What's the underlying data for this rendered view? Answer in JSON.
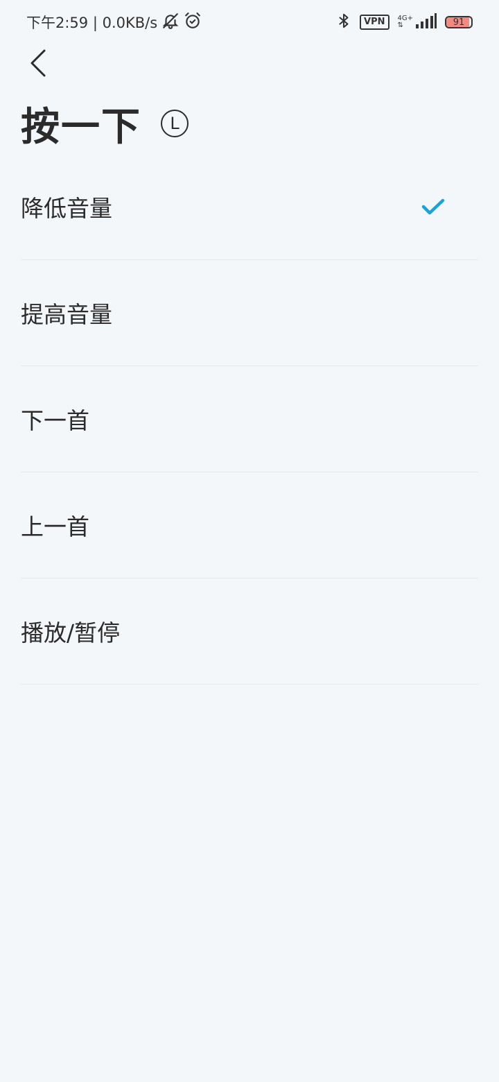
{
  "status_bar": {
    "time_speed": "下午2:59 | 0.0KB/s",
    "vpn_label": "VPN",
    "network_type": "4G+",
    "battery_level": "91",
    "battery_fraction": 0.91,
    "icons": [
      "bell-off-icon",
      "alarm-icon",
      "bluetooth-icon",
      "signal-icon"
    ]
  },
  "header": {
    "title": "按一下",
    "side_badge": "L"
  },
  "options": [
    {
      "label": "降低音量",
      "selected": true
    },
    {
      "label": "提高音量",
      "selected": false
    },
    {
      "label": "下一首",
      "selected": false
    },
    {
      "label": "上一首",
      "selected": false
    },
    {
      "label": "播放/暂停",
      "selected": false
    }
  ],
  "colors": {
    "background": "#f4f7fa",
    "text": "#2b2b2b",
    "accent": "#1aa3d4",
    "divider": "#e4e8ec",
    "battery_fill": "#f28b82"
  }
}
